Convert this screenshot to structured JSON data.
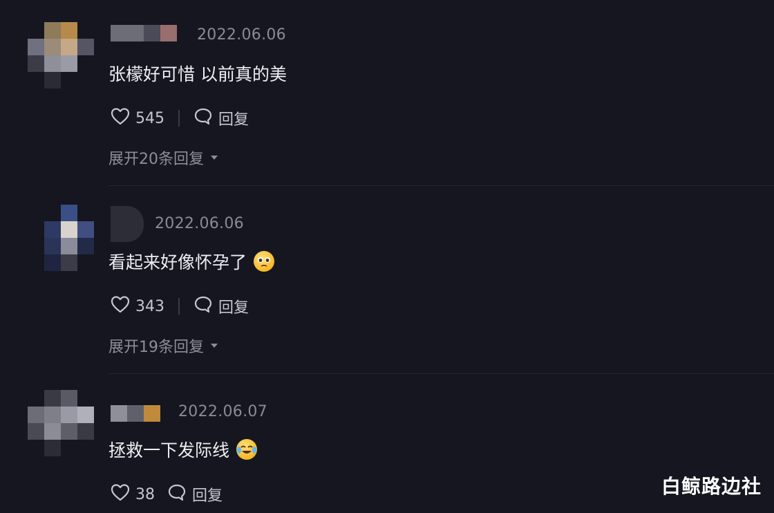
{
  "comments": [
    {
      "date": "2022.06.06",
      "text": "张檬好可惜 以前真的美",
      "likes": "545",
      "reply_label": "回复",
      "expand_label": "展开20条回复",
      "emoji": "",
      "avatar_colors": [
        "#8d7b5a",
        "#b58a4a",
        "#3b3c47",
        "#8e8f98",
        "#9c8b78",
        "#6f7080",
        "#c4a888",
        "#545663",
        "#9a9ba4"
      ],
      "name_colors": [
        "#6c6d76",
        "#4a4b56",
        "#9a6e6e"
      ]
    },
    {
      "date": "2022.06.06",
      "text": "看起来好像怀孕了",
      "likes": "343",
      "reply_label": "回复",
      "expand_label": "展开19条回复",
      "emoji": "pleading-face",
      "avatar_colors": [
        "#1b2035",
        "#3a4f86",
        "#2a3456",
        "#2d3a66",
        "#d9d3ce",
        "#404e80",
        "#222a48",
        "#8a8c9a",
        "#1f2540"
      ],
      "name_colors": [
        "#2c2d36",
        "#2a2b34",
        "#2a2b34"
      ]
    },
    {
      "date": "2022.06.07",
      "text": "拯救一下发际线",
      "likes": "38",
      "reply_label": "回复",
      "expand_label": "",
      "emoji": "tears-of-joy-face",
      "avatar_colors": [
        "#3a3a44",
        "#5a5a66",
        "#7f7f8a",
        "#9a9aa6",
        "#6d6d78",
        "#b0b0ba",
        "#4a4a55",
        "#8c8c96",
        "#5e5e69"
      ],
      "name_colors": [
        "#8e8f98",
        "#5f606b",
        "#c08a3a"
      ]
    }
  ],
  "watermark": "白鲸路边社"
}
